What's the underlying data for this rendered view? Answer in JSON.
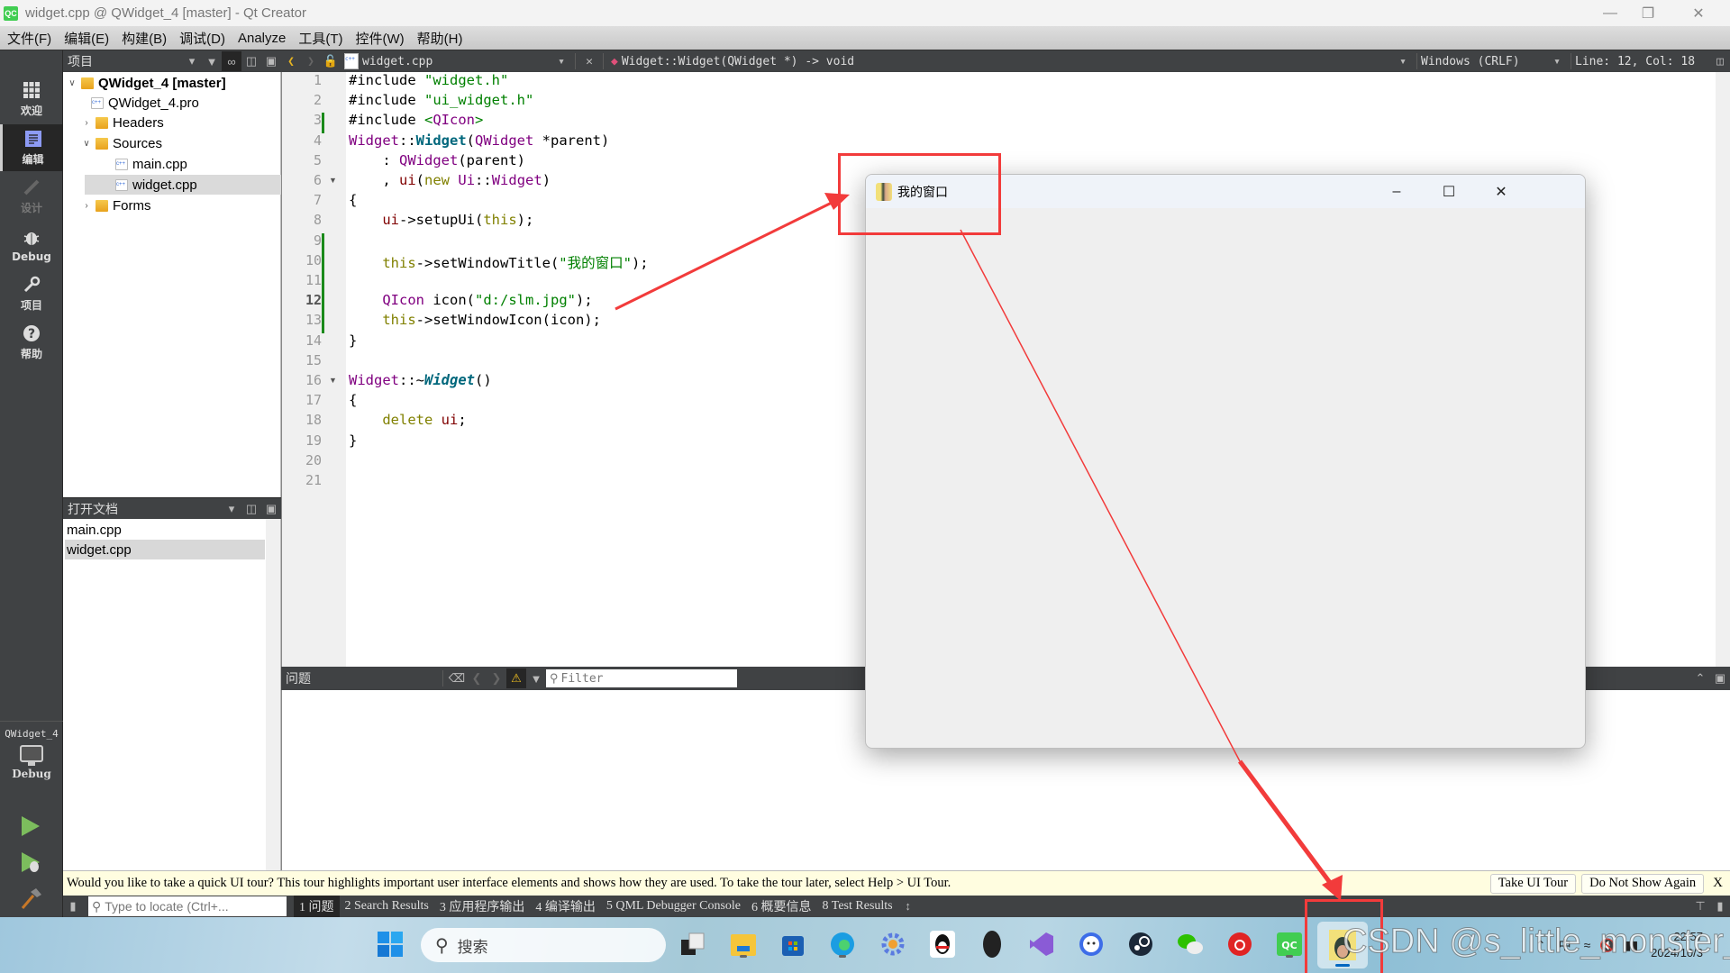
{
  "window": {
    "title": "widget.cpp @ QWidget_4 [master] - Qt Creator",
    "logo": "QC",
    "controls": [
      "minimize-icon",
      "restore-icon",
      "close-icon"
    ]
  },
  "menubar": [
    "文件(F)",
    "编辑(E)",
    "构建(B)",
    "调试(D)",
    "Analyze",
    "工具(T)",
    "控件(W)",
    "帮助(H)"
  ],
  "modebar": {
    "modes": [
      {
        "label": "欢迎",
        "icon": "grid-icon",
        "state": "normal"
      },
      {
        "label": "编辑",
        "icon": "document-icon",
        "state": "active"
      },
      {
        "label": "设计",
        "icon": "pencil-icon",
        "state": "disabled"
      },
      {
        "label": "Debug",
        "icon": "bug-icon",
        "state": "normal"
      },
      {
        "label": "项目",
        "icon": "wrench-icon",
        "state": "normal"
      },
      {
        "label": "帮助",
        "icon": "help-icon",
        "state": "normal"
      }
    ],
    "kit_project": "QWidget_4",
    "kit_config": "Debug",
    "run_buttons": [
      "run-icon",
      "debug-run-icon",
      "build-hammer-icon"
    ]
  },
  "project_panel": {
    "title": "项目",
    "tree": [
      {
        "label": "QWidget_4 [master]",
        "level": 0,
        "expanded": true,
        "type": "project",
        "bold": true
      },
      {
        "label": "QWidget_4.pro",
        "level": 1,
        "type": "pro-file"
      },
      {
        "label": "Headers",
        "level": 1,
        "expanded": false,
        "type": "folder"
      },
      {
        "label": "Sources",
        "level": 1,
        "expanded": true,
        "type": "folder"
      },
      {
        "label": "main.cpp",
        "level": 2,
        "type": "cpp-file"
      },
      {
        "label": "widget.cpp",
        "level": 2,
        "type": "cpp-file",
        "selected": true
      },
      {
        "label": "Forms",
        "level": 1,
        "expanded": false,
        "type": "folder"
      }
    ]
  },
  "open_documents": {
    "title": "打开文档",
    "items": [
      {
        "label": "main.cpp",
        "selected": false
      },
      {
        "label": "widget.cpp",
        "selected": true
      }
    ]
  },
  "editor_toolbar": {
    "file_name": "widget.cpp",
    "symbol": "Widget::Widget(QWidget *) -> void",
    "line_ending": "Windows (CRLF)",
    "cursor_position": "Line: 12, Col: 18"
  },
  "editor": {
    "current_line": 12,
    "modified_lines": [
      3,
      9,
      10,
      11,
      12,
      13
    ],
    "fold_lines": [
      6,
      16
    ],
    "lines": [
      "#include \"widget.h\"",
      "#include \"ui_widget.h\"",
      "#include <QIcon>",
      "Widget::Widget(QWidget *parent)",
      "    : QWidget(parent)",
      "    , ui(new Ui::Widget)",
      "{",
      "    ui->setupUi(this);",
      "",
      "    this->setWindowTitle(\"我的窗口\");",
      "",
      "    QIcon icon(\"d:/slm.jpg\");",
      "    this->setWindowIcon(icon);",
      "}",
      "",
      "Widget::~Widget()",
      "{",
      "    delete ui;",
      "}",
      "",
      ""
    ]
  },
  "issues_pane": {
    "title": "问题",
    "filter_placeholder": "Filter"
  },
  "tour_bar": {
    "message": "Would you like to take a quick UI tour? This tour highlights important user interface elements and shows how they are used. To take the tour later, select Help > UI Tour.",
    "take_tour": "Take UI Tour",
    "dont_show": "Do Not Show Again",
    "close": "X"
  },
  "output_bar": {
    "locator_placeholder": "Type to locate (Ctrl+...",
    "tabs": [
      "1 问题",
      "2 Search Results",
      "3 应用程序输出",
      "4 编译输出",
      "5 QML Debugger Console",
      "6 概要信息",
      "8 Test Results"
    ]
  },
  "app_window": {
    "title": "我的窗口",
    "controls": [
      "minimize-icon",
      "maximize-icon",
      "close-icon"
    ]
  },
  "taskbar": {
    "search_label": "搜索",
    "apps": [
      "task-view",
      "file-explorer",
      "microsoft-store",
      "edge",
      "settings",
      "qq",
      "alienware",
      "visual-studio",
      "bilibili-client",
      "steam",
      "wechat",
      "netease-music",
      "qt-creator",
      "my-window-app"
    ],
    "tray": {
      "ime": "中",
      "time": "22:57",
      "date": "2024/10/3"
    }
  },
  "watermark": "CSDN @s_little_monster_",
  "annotation_color": "#f23b3b"
}
